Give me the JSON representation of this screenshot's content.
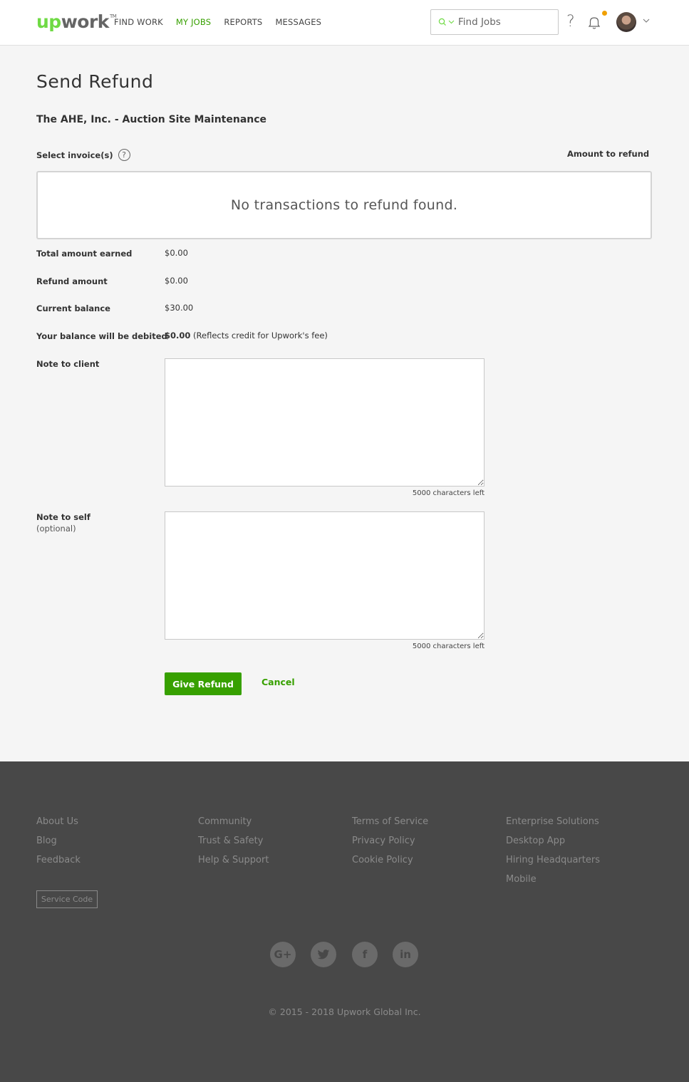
{
  "brand": {
    "logo_main": "up",
    "logo_rest": "work",
    "logo_tm": "TM"
  },
  "nav": {
    "items": [
      {
        "label": "FIND WORK"
      },
      {
        "label": "MY JOBS"
      },
      {
        "label": "REPORTS"
      },
      {
        "label": "MESSAGES"
      }
    ],
    "active_index": 1
  },
  "search": {
    "placeholder": "Find Jobs",
    "icon": "search-icon"
  },
  "header_icons": {
    "help": "?",
    "chevron": "⌵"
  },
  "page": {
    "title": "Send Refund",
    "contract_title": "The AHE, Inc. - Auction Site Maintenance",
    "select_invoices_label": "Select invoice(s)",
    "amount_to_refund_label": "Amount to refund",
    "empty_message": "No transactions to refund found."
  },
  "summary": {
    "total_earned_label": "Total amount earned",
    "total_earned_value": "$0.00",
    "refund_amount_label": "Refund amount",
    "refund_amount_value": "$0.00",
    "current_balance_label": "Current balance",
    "current_balance_value": "$30.00",
    "debited_label": "Your balance will be debited",
    "debited_value": "$0.00",
    "debited_note": "(Reflects credit for Upwork's fee)"
  },
  "notes": {
    "client_label": "Note to client",
    "client_value": "",
    "client_chars_left": "5000 characters left",
    "self_label": "Note to self",
    "self_optional": "(optional)",
    "self_value": "",
    "self_chars_left": "5000 characters left"
  },
  "actions": {
    "give_refund": "Give Refund",
    "cancel": "Cancel"
  },
  "footer": {
    "col1": [
      "About Us",
      "Blog",
      "Feedback"
    ],
    "col2": [
      "Community",
      "Trust & Safety",
      "Help & Support"
    ],
    "col3": [
      "Terms of Service",
      "Privacy Policy",
      "Cookie Policy"
    ],
    "col4": [
      "Enterprise Solutions",
      "Desktop App",
      "Hiring Headquarters",
      "Mobile"
    ],
    "service_code": "Service Code",
    "social": [
      {
        "icon": "google-plus-icon",
        "glyph": "G+"
      },
      {
        "icon": "twitter-icon",
        "glyph": "t"
      },
      {
        "icon": "facebook-icon",
        "glyph": "f"
      },
      {
        "icon": "linkedin-icon",
        "glyph": "in"
      }
    ],
    "copyright": "© 2015 - 2018 Upwork Global Inc."
  },
  "colors": {
    "brand_green": "#6fda44",
    "action_green": "#37a000",
    "footer_bg": "#484848",
    "notification_dot": "#f0a000"
  }
}
